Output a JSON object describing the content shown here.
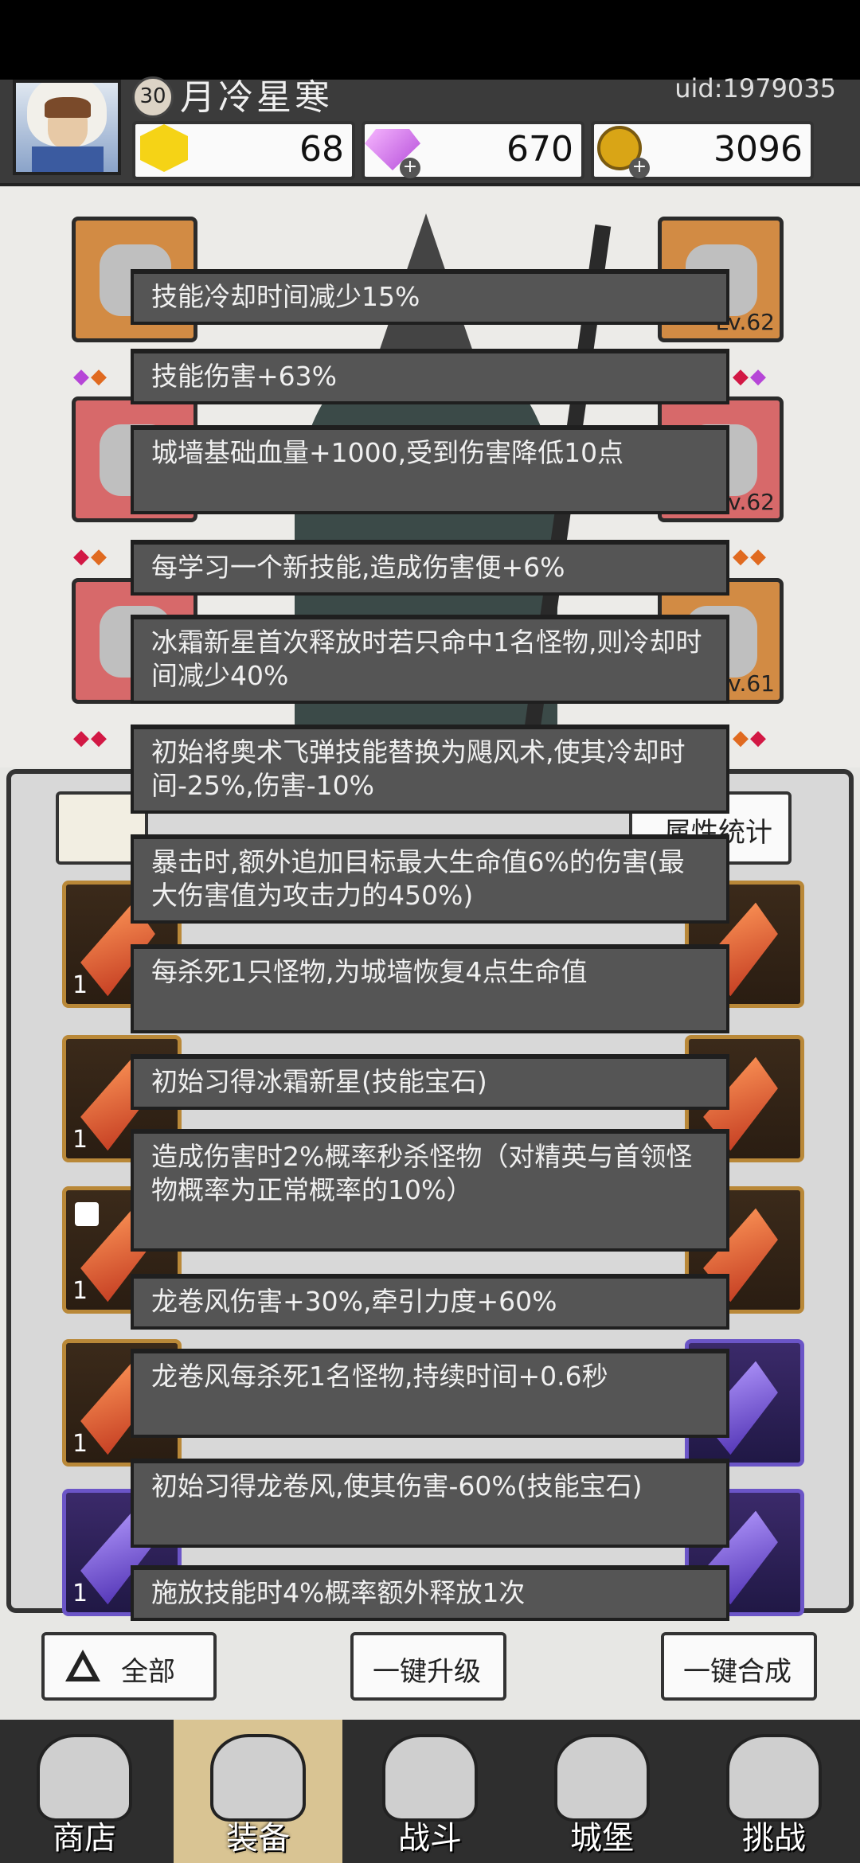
{
  "header": {
    "player_level": "30",
    "player_name": "月冷星寒",
    "uid": "uid:1979035"
  },
  "currencies": {
    "gold_crystal": "68",
    "diamond": "670",
    "coin": "3096"
  },
  "equipment_slots": {
    "right_top_level": "Lv.62",
    "right_mid_level": "Lv.62",
    "right_bottom_level": "Lv.61"
  },
  "inventory": {
    "stats_button_label": "属性统计",
    "counts": [
      "1",
      "1",
      "1",
      "1",
      "1"
    ]
  },
  "skill_tooltip": {
    "entries": [
      "技能冷却时间减少15%",
      "技能伤害+63%",
      "城墙基础血量+1000,受到伤害降低10点",
      "每学习一个新技能,造成伤害便+6%",
      "冰霜新星首次释放时若只命中1名怪物,则冷却时间减少40%",
      "初始将奥术飞弹技能替换为飓风术,使其冷却时间-25%,伤害-10%",
      "暴击时,额外追加目标最大生命值6%的伤害(最大伤害值为攻击力的450%)",
      "每杀死1只怪物,为城墙恢复4点生命值",
      "初始习得冰霜新星(技能宝石)",
      "造成伤害时2%概率秒杀怪物（对精英与首领怪物概率为正常概率的10%）",
      "龙卷风伤害+30%,牵引力度+60%",
      "龙卷风每杀死1名怪物,持续时间+0.6秒",
      "初始习得龙卷风,使其伤害-60%(技能宝石)",
      "施放技能时4%概率额外释放1次"
    ]
  },
  "actions": {
    "filter_label": "全部",
    "upgrade_all_label": "一键升级",
    "merge_all_label": "一键合成"
  },
  "nav": {
    "shop": "商店",
    "equipment": "装备",
    "battle": "战斗",
    "castle": "城堡",
    "challenge": "挑战"
  }
}
